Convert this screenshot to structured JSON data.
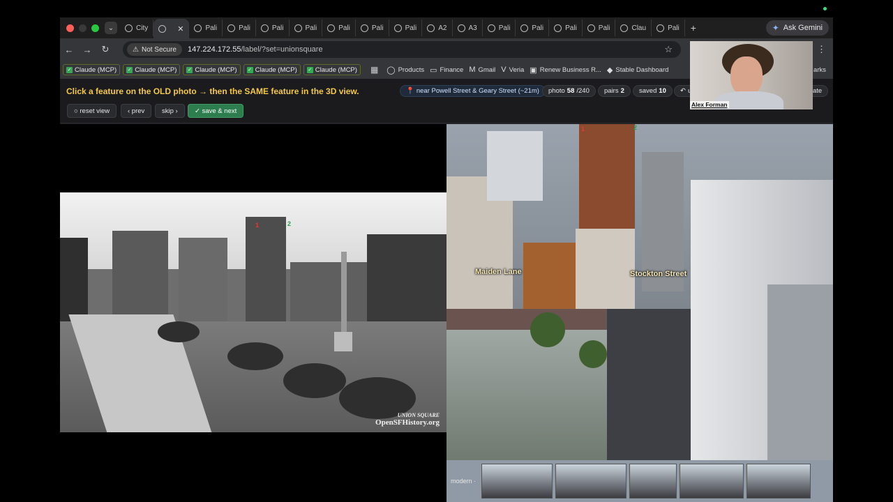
{
  "browser": {
    "tabs": [
      {
        "label": "City",
        "active": false
      },
      {
        "label": "",
        "active": true
      },
      {
        "label": "Pali",
        "active": false
      },
      {
        "label": "Pali",
        "active": false
      },
      {
        "label": "Pali",
        "active": false
      },
      {
        "label": "Pali",
        "active": false
      },
      {
        "label": "Pali",
        "active": false
      },
      {
        "label": "Pali",
        "active": false
      },
      {
        "label": "Pali",
        "active": false
      },
      {
        "label": "A2",
        "active": false
      },
      {
        "label": "A3",
        "active": false
      },
      {
        "label": "Pali",
        "active": false
      },
      {
        "label": "Pali",
        "active": false
      },
      {
        "label": "Pali",
        "active": false
      },
      {
        "label": "Pali",
        "active": false
      },
      {
        "label": "Clau",
        "active": false
      },
      {
        "label": "Pali",
        "active": false
      }
    ],
    "new_tab": "+",
    "gemini_label": "Ask Gemini",
    "not_secure": "Not Secure",
    "url_host": "147.224.172.55",
    "url_path": "/label/?set=unionsquare",
    "bookmarks_mcp": [
      "Claude (MCP)",
      "Claude (MCP)",
      "Claude (MCP)",
      "Claude (MCP)",
      "Claude (MCP)"
    ],
    "bookmarks": [
      {
        "label": "Products",
        "icon": "globe-icon"
      },
      {
        "label": "Finance",
        "icon": "folder-icon"
      },
      {
        "label": "Gmail",
        "icon": "gmail-icon"
      },
      {
        "label": "Veria",
        "icon": "veria-icon"
      },
      {
        "label": "Renew Business R...",
        "icon": "doc-icon"
      },
      {
        "label": "Stable Dashboard",
        "icon": "dashboard-icon"
      }
    ],
    "bookmarks_overflow": "arks"
  },
  "app": {
    "instruction": "Click a feature on the OLD photo → then the SAME feature in the 3D view.",
    "location": "near Powell Street & Geary Street (~21m)",
    "photo_prefix": "photo",
    "photo_current": "58",
    "photo_total": "/240",
    "pairs_label": "pairs",
    "pairs_value": "2",
    "saved_label": "saved",
    "saved_value": "10",
    "undo_partial": "u",
    "update_partial": "ate",
    "buttons": {
      "reset": "○ reset view",
      "prev": "‹ prev",
      "skip": "skip ›",
      "save": "✓ save & next"
    }
  },
  "old_photo": {
    "markers": [
      "1",
      "2"
    ],
    "watermark_title": "OpenSFHistory.org",
    "watermark_caption": "UNION SQUARE"
  },
  "view3d": {
    "labels": [
      "Maiden Lane",
      "Stockton Street"
    ],
    "thumb_label": "modern ·"
  },
  "webcam": {
    "name": "Alex Forman"
  }
}
